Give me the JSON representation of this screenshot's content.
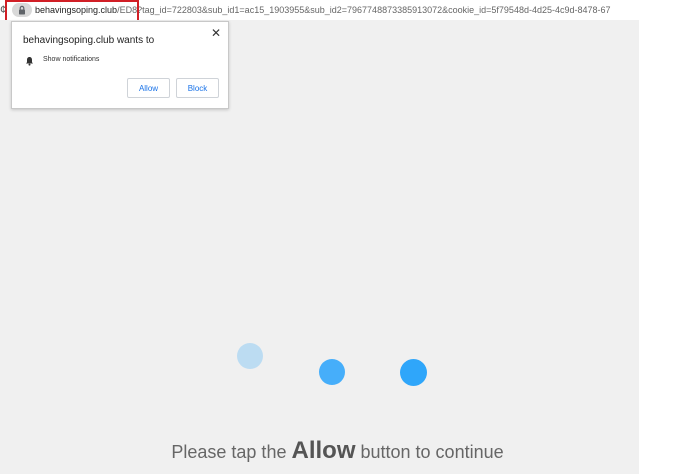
{
  "address_bar": {
    "reload_glyph": "¢",
    "host": "behavingsoping.club",
    "path": "/ED8?tag_id=722803&sub_id1=ac15_1903955&sub_id2=7967748873385913072&cookie_id=5f79548d-4d25-4c9d-8478-67"
  },
  "permission_prompt": {
    "title": "behavingsoping.club wants to",
    "permission_label": "Show notifications",
    "allow_label": "Allow",
    "block_label": "Block",
    "close_glyph": "✕"
  },
  "page": {
    "instruction_before": "Please tap the",
    "instruction_emphasis": "Allow",
    "instruction_after": "button to continue"
  },
  "colors": {
    "highlight_border": "#d11f26",
    "link_blue": "#1a73e8",
    "loader_dot_light": "#bcdcf2",
    "loader_dot": "#46aefa",
    "page_background": "#f0f0f0"
  },
  "icons": {
    "lock": "lock-icon",
    "bell": "bell-icon",
    "close": "close-icon"
  }
}
